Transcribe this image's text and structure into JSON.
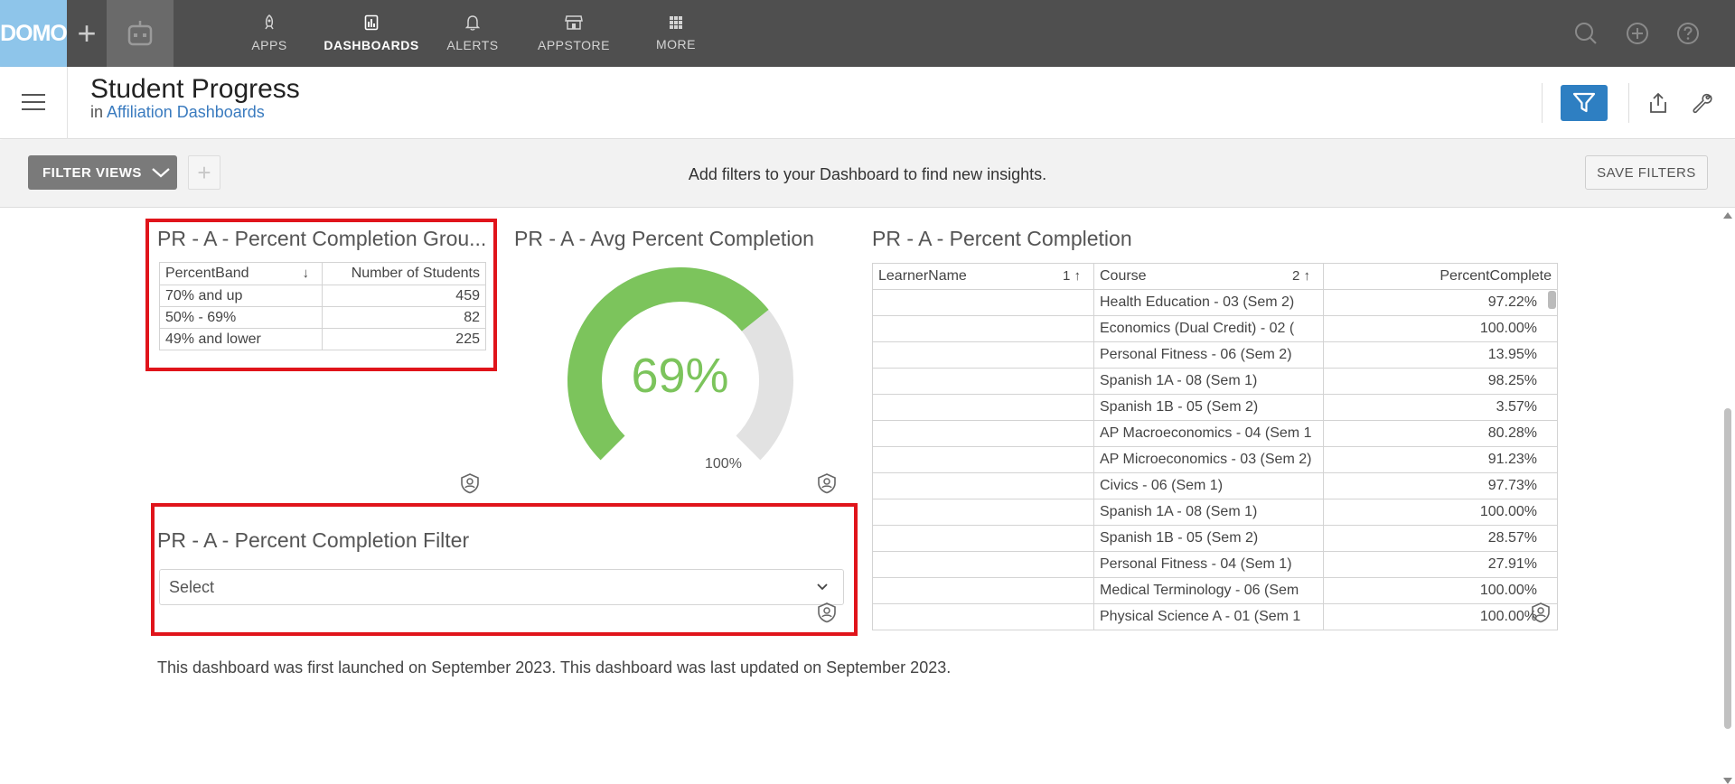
{
  "topnav": {
    "logo": "DOMO",
    "items": [
      {
        "label": "APPS",
        "icon": "rocket-icon"
      },
      {
        "label": "DASHBOARDS",
        "icon": "dashboard-icon"
      },
      {
        "label": "ALERTS",
        "icon": "bell-icon"
      },
      {
        "label": "APPSTORE",
        "icon": "store-icon"
      },
      {
        "label": "MORE",
        "icon": "grid-icon"
      }
    ]
  },
  "header": {
    "title": "Student Progress",
    "sub_prefix": "in",
    "sub_link": "Affiliation Dashboards"
  },
  "filterbar": {
    "filter_views": "FILTER VIEWS",
    "message": "Add filters to your Dashboard to find new insights.",
    "save": "SAVE FILTERS"
  },
  "card_group": {
    "title": "PR - A - Percent Completion Grou...",
    "columns": [
      "PercentBand",
      "Number of Students"
    ],
    "rows": [
      {
        "band": "70% and up",
        "count": "459"
      },
      {
        "band": "50% - 69%",
        "count": "82"
      },
      {
        "band": "49% and lower",
        "count": "225"
      }
    ]
  },
  "card_gauge": {
    "title": "PR - A - Avg Percent Completion",
    "value_label": "69%",
    "value": 0.69,
    "max_label": "100%",
    "fill_color": "#7cc45c",
    "track_color": "#e2e2e2"
  },
  "card_filter": {
    "title": "PR - A - Percent Completion Filter",
    "placeholder": "Select"
  },
  "card_table": {
    "title": "PR - A - Percent Completion",
    "columns": [
      "LearnerName",
      "Course",
      "PercentComplete"
    ],
    "sort_learner": "1",
    "sort_course": "2",
    "rows": [
      {
        "learner": "",
        "course": "Health Education - 03 (Sem 2)",
        "pct": "97.22%"
      },
      {
        "learner": "",
        "course": "Economics (Dual Credit) - 02 (",
        "pct": "100.00%"
      },
      {
        "learner": "",
        "course": "Personal Fitness - 06 (Sem 2)",
        "pct": "13.95%"
      },
      {
        "learner": "",
        "course": "Spanish 1A - 08 (Sem 1)",
        "pct": "98.25%"
      },
      {
        "learner": "",
        "course": "Spanish 1B - 05 (Sem 2)",
        "pct": "3.57%"
      },
      {
        "learner": "",
        "course": "AP Macroeconomics  - 04 (Sem 1",
        "pct": "80.28%"
      },
      {
        "learner": "",
        "course": "AP Microeconomics - 03 (Sem 2)",
        "pct": "91.23%"
      },
      {
        "learner": "",
        "course": "Civics - 06 (Sem 1)",
        "pct": "97.73%"
      },
      {
        "learner": "",
        "course": "Spanish 1A - 08 (Sem 1)",
        "pct": "100.00%"
      },
      {
        "learner": "",
        "course": "Spanish 1B - 05 (Sem 2)",
        "pct": "28.57%"
      },
      {
        "learner": "",
        "course": "Personal Fitness - 04 (Sem 1)",
        "pct": "27.91%"
      },
      {
        "learner": "",
        "course": "Medical Terminology - 06 (Sem",
        "pct": "100.00%"
      },
      {
        "learner": "",
        "course": "Physical Science A - 01 (Sem 1",
        "pct": "100.00%"
      }
    ]
  },
  "footer_note": "This dashboard was first launched on September 2023. This dashboard was last updated on September 2023."
}
